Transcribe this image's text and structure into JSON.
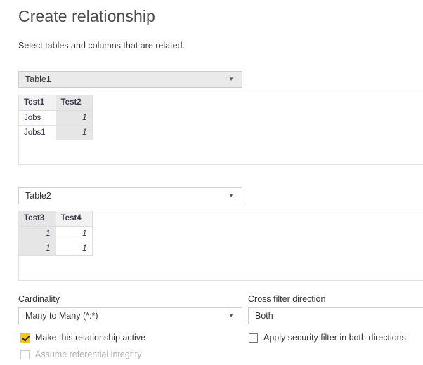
{
  "dialog": {
    "title": "Create relationship",
    "subtitle": "Select tables and columns that are related."
  },
  "table1_selector": {
    "name": "table1-dropdown",
    "value": "Table1",
    "caret": "chevron-down-icon"
  },
  "table1_preview": {
    "columns": [
      "Test1",
      "Test2"
    ],
    "selected_column": "Test2",
    "rows": [
      [
        "Jobs",
        "1"
      ],
      [
        "Jobs1",
        "1"
      ]
    ]
  },
  "table2_selector": {
    "name": "table2-dropdown",
    "value": "Table2",
    "caret": "chevron-down-icon"
  },
  "table2_preview": {
    "columns": [
      "Test3",
      "Test4"
    ],
    "selected_column": "Test3",
    "rows": [
      [
        "1",
        "1"
      ],
      [
        "1",
        "1"
      ]
    ]
  },
  "cardinality": {
    "label": "Cardinality",
    "value": "Many to Many (*:*)"
  },
  "cross_filter": {
    "label": "Cross filter direction",
    "value": "Both"
  },
  "options": {
    "make_active": {
      "label": "Make this relationship active",
      "checked": true,
      "enabled": true
    },
    "referential_integrity": {
      "label": "Assume referential integrity",
      "checked": false,
      "enabled": false
    },
    "security_filter": {
      "label": "Apply security filter in both directions",
      "checked": false,
      "enabled": true
    }
  },
  "colors": {
    "accent": "#f2c811",
    "title": "#4c4c4c",
    "text": "#333333",
    "grid_header_bg": "#f2f2f2",
    "selected_column_bg": "#e6e6e6",
    "border": "#e2e2e2"
  }
}
